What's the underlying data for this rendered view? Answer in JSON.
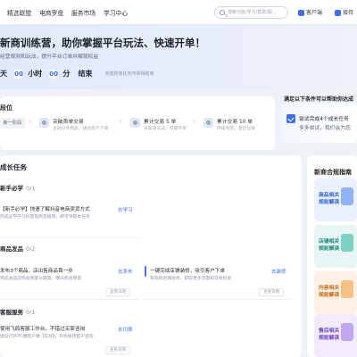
{
  "nav": {
    "items": [
      "精选联盟",
      "电商罗盘",
      "服务市场",
      "学习中心"
    ],
    "search_placeholder": "搜索功能/学习/帮助/服...",
    "right_links": [
      "客户端",
      "接待"
    ]
  },
  "hero": {
    "title": "新商训练营，助你掌握平台玩法、快速开单！",
    "subtitle": "经营规则和玩法，提升平台订单并解锁权益",
    "countdown": {
      "days_unit": "天",
      "hours": "00",
      "hours_unit": "小时",
      "minutes": "00",
      "minutes_unit": "分",
      "end_text": "结束"
    },
    "note": "完成所有任务可获得结束"
  },
  "levels": {
    "title": "段位",
    "current_tag": "新一阶段",
    "steps": [
      {
        "title": "突破首单交易",
        "desc": "主动分享商品，通达客户下单"
      },
      {
        "title": "累计交易 5 单",
        "desc": "多渠道试试，积累开单"
      },
      {
        "title": "累计交易 10 单",
        "desc": "持续经营，稳定出单"
      }
    ]
  },
  "tip": {
    "header": "满足以下条件可以帮助你达成",
    "line1": "尝试完成4个成长任务",
    "line2": "多多尝试，我们会为您"
  },
  "tasks": {
    "title": "成长任务",
    "groups": [
      {
        "title": "新手必学",
        "count": "0/1",
        "items": [
          {
            "title": "【新手必学】快速了解抖音电商卖货方式",
            "desc": "完成必学学习抖音电商及规则，即可领取本任务",
            "action": "去学习"
          }
        ]
      },
      {
        "title": "商品发品",
        "count": "0/2",
        "items": [
          {
            "title": "发布3个商品，店出售商品首一步",
            "desc": "完成发品前商品质量分越高，曝光机会更高",
            "action": "去发布",
            "tag": "查看攻略"
          },
          {
            "title": "一键完成店铺装修，吸引客户下单",
            "desc": "有效的店铺装修，获取更多流量和交易机会",
            "action": "去装修",
            "tag": "查看攻略"
          }
        ]
      },
      {
        "title": "客服服务",
        "count": "0/1",
        "items": [
          {
            "title": "使用飞鸽客服工作台，不错过买家咨询",
            "desc": "建议打开PC端客户端【在线】，开始接待客户咨询",
            "action": "去切换",
            "tag": "查看攻略"
          }
        ]
      }
    ]
  },
  "compliance": {
    "title": "新商合规指南",
    "items": [
      {
        "text": "商品相关\n规则解读",
        "bg": "#eaf1fd",
        "color": "#2f5fd0",
        "art": "#8fb3f5"
      },
      {
        "text": "店铺相关\n规则解读",
        "bg": "#e7f6f4",
        "color": "#16857a",
        "art": "#7fd1c6"
      },
      {
        "text": "内容相关\n规则解读",
        "bg": "#fdf1e5",
        "color": "#c26a12",
        "art": "#f5c185"
      },
      {
        "text": "售后相关\n规则解读",
        "bg": "#f1ebfb",
        "color": "#6b43c2",
        "art": "#bfa6ee"
      }
    ]
  },
  "colors": {
    "accent": "#3f6fe8",
    "page_bg": "#eef2f7"
  }
}
